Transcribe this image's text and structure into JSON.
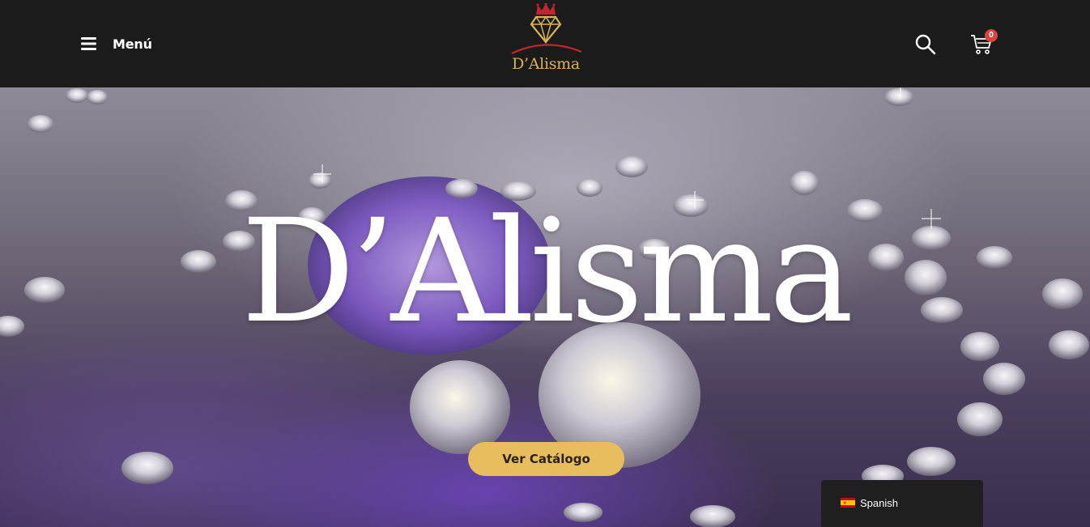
{
  "header": {
    "menu_label": "Menú",
    "logo_text": "D’Alisma",
    "cart_count": "0"
  },
  "hero": {
    "title": "D’Alisma",
    "cta_label": "Ver Catálogo"
  },
  "language_switcher": {
    "label": "Spanish"
  },
  "colors": {
    "header_bg": "#1c1b1c",
    "accent_gold": "#e7bd5d",
    "badge_red": "#d64541"
  }
}
